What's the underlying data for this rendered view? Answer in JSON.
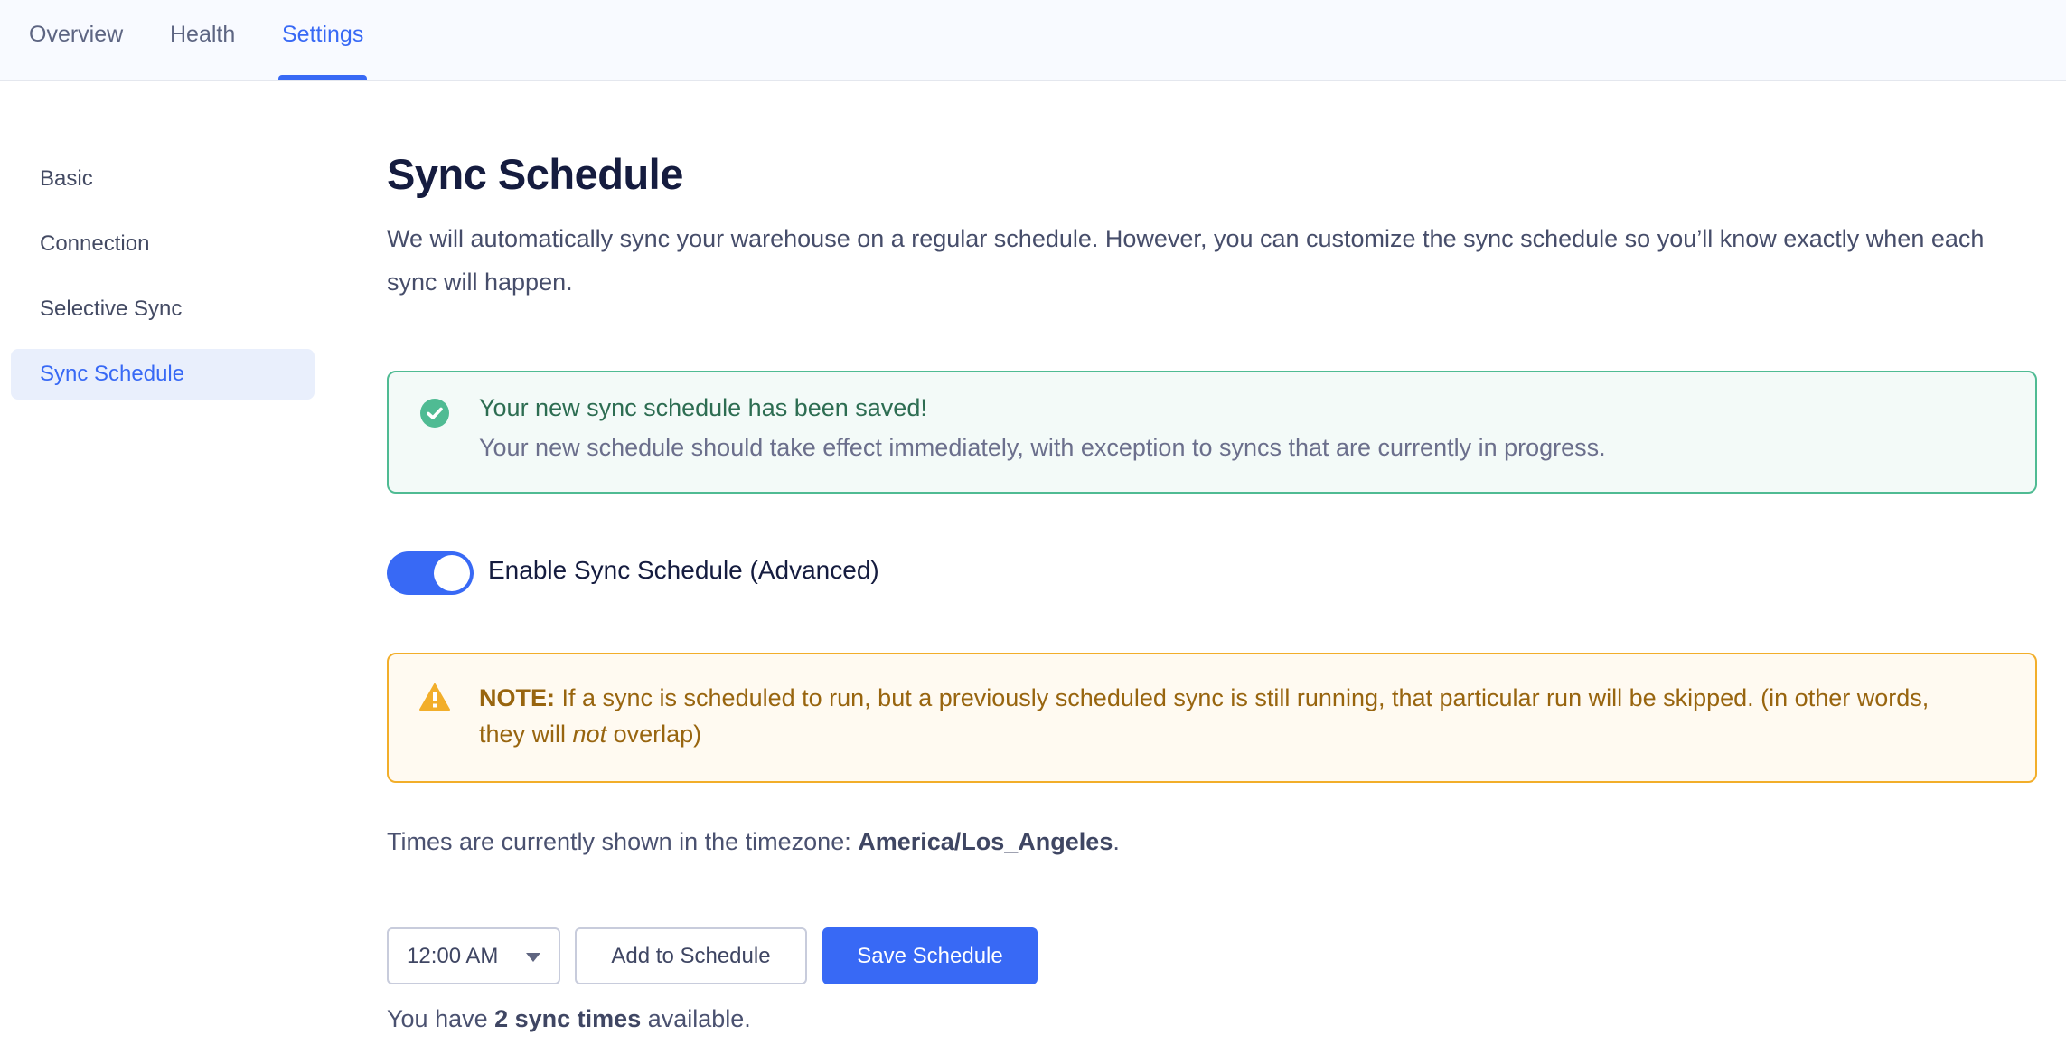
{
  "tabs": [
    {
      "label": "Overview",
      "active": false
    },
    {
      "label": "Health",
      "active": false
    },
    {
      "label": "Settings",
      "active": true
    }
  ],
  "sidebar": {
    "items": [
      {
        "label": "Basic",
        "active": false
      },
      {
        "label": "Connection",
        "active": false
      },
      {
        "label": "Selective Sync",
        "active": false
      },
      {
        "label": "Sync Schedule",
        "active": true
      }
    ]
  },
  "page": {
    "title": "Sync Schedule",
    "description": "We will automatically sync your warehouse on a regular schedule. However, you can customize the sync schedule so you’ll know exactly when each sync will happen."
  },
  "success_alert": {
    "icon": "check-circle-icon",
    "title": "Your new sync schedule has been saved!",
    "body": "Your new schedule should take effect immediately, with exception to syncs that are currently in progress.",
    "color": "#4fbb93"
  },
  "toggle": {
    "label": "Enable Sync Schedule (Advanced)",
    "on": true,
    "color": "#3869f5"
  },
  "warning_alert": {
    "icon": "warning-triangle-icon",
    "prefix": "NOTE:",
    "text_before_emphasis": " If a sync is scheduled to run, but a previously scheduled sync is still running, that particular run will be skipped. (in other words, they will ",
    "emphasis": "not",
    "text_after_emphasis": " overlap)",
    "color": "#f2ae2a"
  },
  "timezone": {
    "prefix": "Times are currently shown in the timezone: ",
    "value": "America/Los_Angeles",
    "suffix": "."
  },
  "controls": {
    "time_select_value": "12:00 AM",
    "add_button_label": "Add to Schedule",
    "save_button_label": "Save Schedule"
  },
  "availability": {
    "prefix": "You have ",
    "count_text": "2 sync times",
    "suffix": " available."
  },
  "colors": {
    "accent": "#3869f5",
    "success": "#4fbb93",
    "warning": "#f2ae2a"
  }
}
